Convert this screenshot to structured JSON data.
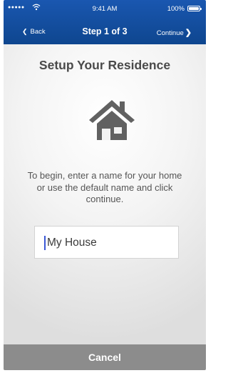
{
  "status_bar": {
    "signal": "●●●●●",
    "time": "9:41 AM",
    "battery": "100%"
  },
  "nav": {
    "back_label": "Back",
    "title": "Step 1 of 3",
    "continue_label": "Continue"
  },
  "main": {
    "heading": "Setup Your Residence",
    "icon": "house-icon",
    "instructions": "To begin,  enter a name for your home or use the default name and click continue.",
    "name_input_value": "My House"
  },
  "footer": {
    "cancel_label": "Cancel"
  },
  "colors": {
    "header": "#1552a6",
    "heading_text": "#4a4a4a",
    "icon": "#616161",
    "caret": "#3a57d6",
    "cancel_bar": "#8c8c8c"
  }
}
